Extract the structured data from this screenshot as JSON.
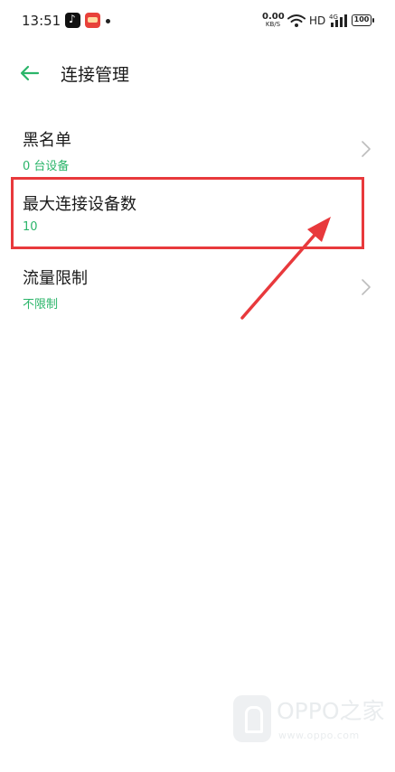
{
  "status_bar": {
    "time": "13:51",
    "net_speed_value": "0.00",
    "net_speed_unit": "KB/S",
    "hd_label": "HD",
    "signal_label": "4G",
    "battery_level": "100"
  },
  "header": {
    "title": "连接管理"
  },
  "items": [
    {
      "title": "黑名单",
      "subtitle": "0 台设备",
      "has_chevron": true
    },
    {
      "title": "最大连接设备数",
      "subtitle": "10",
      "has_chevron": false
    },
    {
      "title": "流量限制",
      "subtitle": "不限制",
      "has_chevron": true
    }
  ],
  "watermark": {
    "brand": "OPPO之家",
    "url": "www.oppo.com"
  },
  "colors": {
    "accent": "#2bb56a",
    "highlight": "#e8393c",
    "text": "#1a1a1a",
    "chevron": "#bdbdbd"
  },
  "icons": {
    "back": "arrow-left-icon",
    "chevron": "chevron-right-icon",
    "wifi": "wifi-icon",
    "signal": "signal-icon",
    "battery": "battery-icon"
  }
}
